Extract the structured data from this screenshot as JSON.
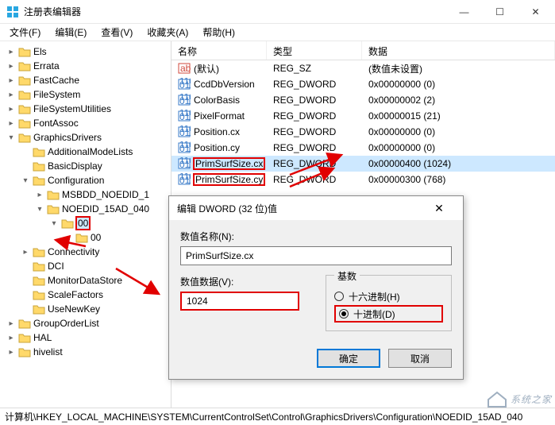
{
  "window": {
    "title": "注册表编辑器",
    "min": "—",
    "max": "☐",
    "close": "✕"
  },
  "menu": {
    "file": "文件(F)",
    "edit": "编辑(E)",
    "view": "查看(V)",
    "favorites": "收藏夹(A)",
    "help": "帮助(H)"
  },
  "tree": [
    {
      "depth": 0,
      "twisty": ">",
      "label": "Els"
    },
    {
      "depth": 0,
      "twisty": ">",
      "label": "Errata"
    },
    {
      "depth": 0,
      "twisty": ">",
      "label": "FastCache"
    },
    {
      "depth": 0,
      "twisty": ">",
      "label": "FileSystem"
    },
    {
      "depth": 0,
      "twisty": ">",
      "label": "FileSystemUtilities"
    },
    {
      "depth": 0,
      "twisty": ">",
      "label": "FontAssoc"
    },
    {
      "depth": 0,
      "twisty": "v",
      "label": "GraphicsDrivers"
    },
    {
      "depth": 1,
      "twisty": "",
      "label": "AdditionalModeLists"
    },
    {
      "depth": 1,
      "twisty": "",
      "label": "BasicDisplay"
    },
    {
      "depth": 1,
      "twisty": "v",
      "label": "Configuration"
    },
    {
      "depth": 2,
      "twisty": ">",
      "label": "MSBDD_NOEDID_1"
    },
    {
      "depth": 2,
      "twisty": "v",
      "label": "NOEDID_15AD_040"
    },
    {
      "depth": 3,
      "twisty": "v",
      "label": "00",
      "selected": true,
      "hl": true
    },
    {
      "depth": 4,
      "twisty": "",
      "label": "00"
    },
    {
      "depth": 1,
      "twisty": ">",
      "label": "Connectivity"
    },
    {
      "depth": 1,
      "twisty": "",
      "label": "DCI"
    },
    {
      "depth": 1,
      "twisty": "",
      "label": "MonitorDataStore"
    },
    {
      "depth": 1,
      "twisty": "",
      "label": "ScaleFactors"
    },
    {
      "depth": 1,
      "twisty": "",
      "label": "UseNewKey"
    },
    {
      "depth": 0,
      "twisty": ">",
      "label": "GroupOrderList"
    },
    {
      "depth": 0,
      "twisty": ">",
      "label": "HAL"
    },
    {
      "depth": 0,
      "twisty": ">",
      "label": "hivelist"
    }
  ],
  "list": {
    "headers": {
      "name": "名称",
      "type": "类型",
      "data": "数据"
    },
    "rows": [
      {
        "icon": "str",
        "name": "(默认)",
        "type": "REG_SZ",
        "data": "(数值未设置)"
      },
      {
        "icon": "bin",
        "name": "CcdDbVersion",
        "type": "REG_DWORD",
        "data": "0x00000000 (0)"
      },
      {
        "icon": "bin",
        "name": "ColorBasis",
        "type": "REG_DWORD",
        "data": "0x00000002 (2)"
      },
      {
        "icon": "bin",
        "name": "PixelFormat",
        "type": "REG_DWORD",
        "data": "0x00000015 (21)"
      },
      {
        "icon": "bin",
        "name": "Position.cx",
        "type": "REG_DWORD",
        "data": "0x00000000 (0)"
      },
      {
        "icon": "bin",
        "name": "Position.cy",
        "type": "REG_DWORD",
        "data": "0x00000000 (0)"
      },
      {
        "icon": "bin",
        "name": "PrimSurfSize.cx",
        "type": "REG_DWORD",
        "data": "0x00000400 (1024)",
        "selected": true,
        "hl": true
      },
      {
        "icon": "bin",
        "name": "PrimSurfSize.cy",
        "type": "REG_DWORD",
        "data": "0x00000300 (768)",
        "hl": true
      }
    ]
  },
  "statusbar": "计算机\\HKEY_LOCAL_MACHINE\\SYSTEM\\CurrentControlSet\\Control\\GraphicsDrivers\\Configuration\\NOEDID_15AD_040",
  "dialog": {
    "title": "编辑 DWORD (32 位)值",
    "name_label": "数值名称(N):",
    "name_value": "PrimSurfSize.cx",
    "data_label": "数值数据(V):",
    "data_value": "1024",
    "base_label": "基数",
    "radix_hex": "十六进制(H)",
    "radix_dec": "十进制(D)",
    "ok": "确定",
    "cancel": "取消"
  },
  "watermark": "系统之家"
}
